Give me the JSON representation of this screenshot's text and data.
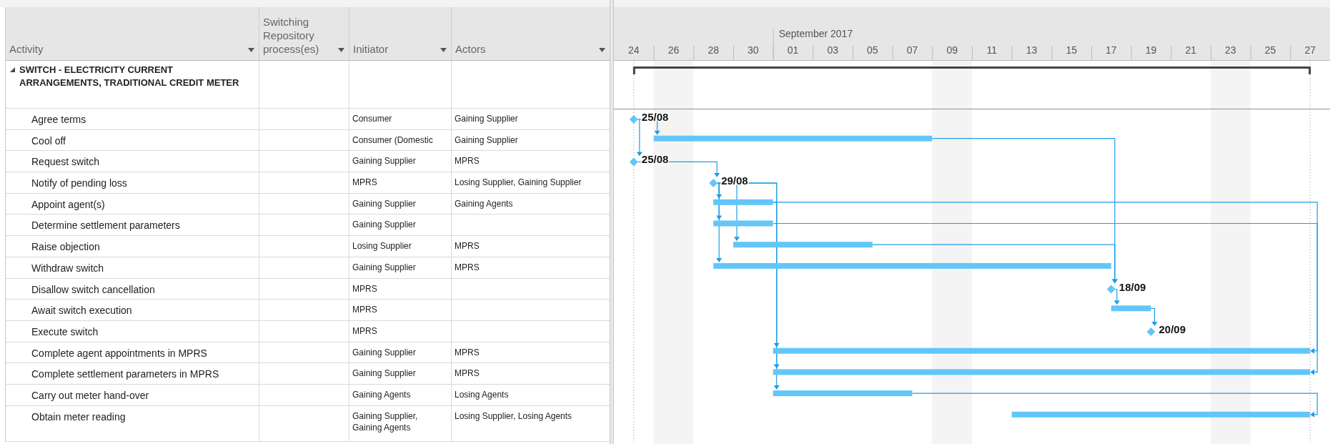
{
  "columns": [
    {
      "label": "Activity"
    },
    {
      "label": "Switching Repository process(es)"
    },
    {
      "label": "Initiator"
    },
    {
      "label": "Actors"
    }
  ],
  "summary": {
    "name": "SWITCH - ELECTRICITY CURRENT ARRANGEMENTS, TRADITIONAL CREDIT METER",
    "expanded": true
  },
  "tasks": [
    {
      "name": "Agree terms",
      "initiator": "Consumer",
      "actors": "Gaining Supplier",
      "kind": "milestone",
      "label": "25/08"
    },
    {
      "name": "Cool off",
      "initiator": "Consumer (Domestic",
      "actors": "Gaining Supplier",
      "kind": "bar"
    },
    {
      "name": "Request switch",
      "initiator": "Gaining Supplier",
      "actors": "MPRS",
      "kind": "milestone",
      "label": "25/08"
    },
    {
      "name": "Notify of pending loss",
      "initiator": "MPRS",
      "actors": "Losing Supplier, Gaining Supplier",
      "kind": "milestone",
      "label": "29/08"
    },
    {
      "name": "Appoint agent(s)",
      "initiator": "Gaining Supplier",
      "actors": "Gaining Agents",
      "kind": "bar"
    },
    {
      "name": "Determine settlement parameters",
      "initiator": "Gaining Supplier",
      "kind": "bar"
    },
    {
      "name": "Raise objection",
      "initiator": "Losing Supplier",
      "actors": "MPRS",
      "kind": "bar"
    },
    {
      "name": "Withdraw switch",
      "initiator": "Gaining Supplier",
      "actors": "MPRS",
      "kind": "bar"
    },
    {
      "name": "Disallow switch cancellation",
      "initiator": "MPRS",
      "kind": "milestone",
      "label": "18/09"
    },
    {
      "name": "Await switch execution",
      "initiator": "MPRS",
      "kind": "bar"
    },
    {
      "name": "Execute switch",
      "initiator": "MPRS",
      "kind": "milestone",
      "label": "20/09"
    },
    {
      "name": "Complete agent appointments in MPRS",
      "initiator": "Gaining Supplier",
      "actors": "MPRS",
      "kind": "bar"
    },
    {
      "name": "Complete settlement parameters in MPRS",
      "initiator": "Gaining Supplier",
      "actors": "MPRS",
      "kind": "bar"
    },
    {
      "name": "Carry out meter hand-over",
      "initiator": "Gaining Agents",
      "actors": "Losing Agents",
      "kind": "bar"
    },
    {
      "name": "Obtain meter reading",
      "initiator": "Gaining Supplier, Gaining Agents",
      "actors": "Losing Supplier, Losing Agents",
      "kind": "bar"
    }
  ],
  "gantt": {
    "month": "September 2017",
    "ticks": [
      "24",
      "26",
      "28",
      "30",
      "01",
      "03",
      "05",
      "07",
      "09",
      "11",
      "13",
      "15",
      "17",
      "19",
      "21",
      "23",
      "25",
      "27"
    ]
  }
}
